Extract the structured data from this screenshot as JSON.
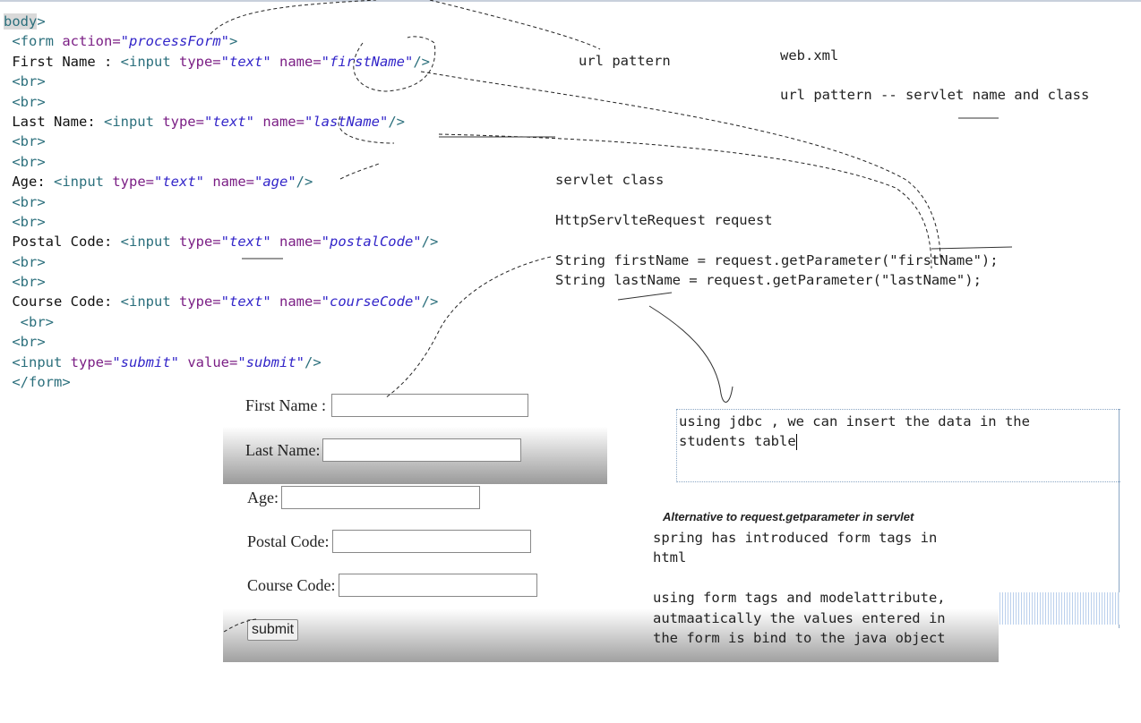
{
  "code_lines": [
    [
      {
        "c": "sel",
        "t": "body"
      },
      {
        "c": "tag",
        "t": ">"
      }
    ],
    [
      {
        "c": "text",
        "t": " "
      },
      {
        "c": "tag",
        "t": "<form "
      },
      {
        "c": "attr",
        "t": "action="
      },
      {
        "c": "val",
        "t": "\"processForm\""
      },
      {
        "c": "tag",
        "t": ">"
      }
    ],
    [
      {
        "c": "text",
        "t": " First Name : "
      },
      {
        "c": "tag",
        "t": "<input "
      },
      {
        "c": "attr",
        "t": "type="
      },
      {
        "c": "val",
        "t": "\"text\""
      },
      {
        "c": "attr",
        "t": " name="
      },
      {
        "c": "val",
        "t": "\"firstName\""
      },
      {
        "c": "tag",
        "t": "/>"
      }
    ],
    [
      {
        "c": "tag",
        "t": " <br>"
      }
    ],
    [
      {
        "c": "tag",
        "t": " <br>"
      }
    ],
    [
      {
        "c": "text",
        "t": " Last Name: "
      },
      {
        "c": "tag",
        "t": "<input "
      },
      {
        "c": "attr",
        "t": "type="
      },
      {
        "c": "val",
        "t": "\"text\""
      },
      {
        "c": "attr",
        "t": " name="
      },
      {
        "c": "val",
        "t": "\"lastName\""
      },
      {
        "c": "tag",
        "t": "/>"
      }
    ],
    [
      {
        "c": "tag",
        "t": " <br>"
      }
    ],
    [
      {
        "c": "tag",
        "t": " <br>"
      }
    ],
    [
      {
        "c": "text",
        "t": " Age: "
      },
      {
        "c": "tag",
        "t": "<input "
      },
      {
        "c": "attr",
        "t": "type="
      },
      {
        "c": "val",
        "t": "\"text\""
      },
      {
        "c": "attr",
        "t": " name="
      },
      {
        "c": "val",
        "t": "\"age\""
      },
      {
        "c": "tag",
        "t": "/>"
      }
    ],
    [
      {
        "c": "tag",
        "t": " <br>"
      }
    ],
    [
      {
        "c": "tag",
        "t": " <br>"
      }
    ],
    [
      {
        "c": "text",
        "t": " Postal Code: "
      },
      {
        "c": "tag",
        "t": "<input "
      },
      {
        "c": "attr",
        "t": "type="
      },
      {
        "c": "val",
        "t": "\"text\""
      },
      {
        "c": "attr",
        "t": " name="
      },
      {
        "c": "val",
        "t": "\"postalCode\""
      },
      {
        "c": "tag",
        "t": "/>"
      }
    ],
    [
      {
        "c": "tag",
        "t": " <br>"
      }
    ],
    [
      {
        "c": "tag",
        "t": " <br>"
      }
    ],
    [
      {
        "c": "text",
        "t": " Course Code: "
      },
      {
        "c": "tag",
        "t": "<input "
      },
      {
        "c": "attr",
        "t": "type="
      },
      {
        "c": "val",
        "t": "\"text\""
      },
      {
        "c": "attr",
        "t": " name="
      },
      {
        "c": "val",
        "t": "\"courseCode\""
      },
      {
        "c": "tag",
        "t": "/>"
      }
    ],
    [
      {
        "c": "tag",
        "t": "  <br>"
      }
    ],
    [
      {
        "c": "tag",
        "t": " <br>"
      }
    ],
    [
      {
        "c": "text",
        "t": " "
      },
      {
        "c": "tag",
        "t": "<input "
      },
      {
        "c": "attr",
        "t": "type="
      },
      {
        "c": "val",
        "t": "\"submit\""
      },
      {
        "c": "attr",
        "t": " value="
      },
      {
        "c": "val",
        "t": "\"submit\""
      },
      {
        "c": "tag",
        "t": "/>"
      }
    ],
    [
      {
        "c": "tag",
        "t": " </form>"
      }
    ]
  ],
  "notes": {
    "url_pattern": "url pattern",
    "web_xml": "web.xml",
    "url_mapping": "url pattern -- servlet name and class",
    "servlet_class": "servlet class",
    "request_decl": "HttpServlteRequest request",
    "first_name_line": "String firstName = request.getParameter(\"firstName\");",
    "last_name_line": "String lastName = request.getParameter(\"lastName\");"
  },
  "form_preview": {
    "first_name_label": "First Name :",
    "last_name_label": "Last Name:",
    "age_label": "Age:",
    "postal_code_label": "Postal Code:",
    "course_code_label": "Course Code:",
    "submit_label": "submit"
  },
  "jdbc_note": "using jdbc , we can insert the data in the\nstudents table",
  "alternative": {
    "title": "Alternative to request.getparameter in servlet",
    "body": "spring has introduced form tags in\nhtml\n\nusing form tags and modelattribute,\nautmaatically the values entered in\nthe form is bind to the java object"
  }
}
